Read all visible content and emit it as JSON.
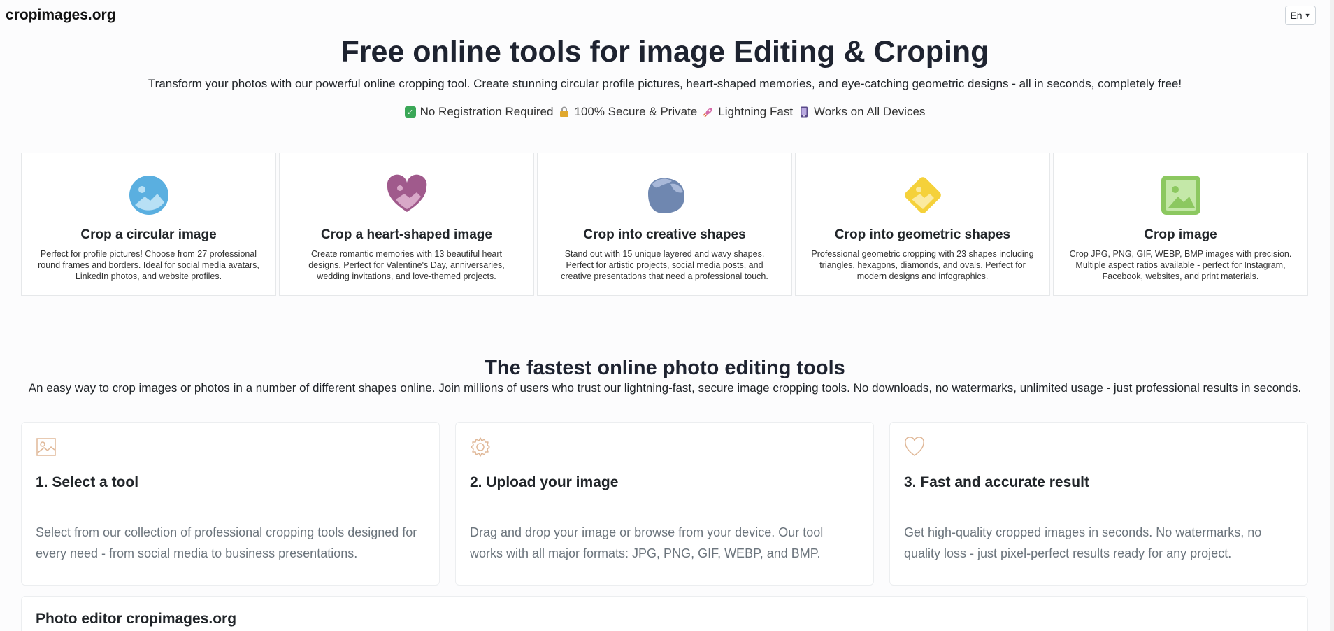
{
  "header": {
    "brand": "cropimages.org",
    "language": "En"
  },
  "hero": {
    "title": "Free online tools for image Editing & Croping",
    "subtitle": "Transform your photos with our powerful online cropping tool. Create stunning circular profile pictures, heart-shaped memories, and eye-catching geometric designs - all in seconds, completely free!",
    "features": [
      {
        "icon": "check-icon",
        "color": "#3aa757",
        "glyph": "✓",
        "label": "No Registration Required"
      },
      {
        "icon": "lock-icon",
        "color": "#e0a82e",
        "glyph": "",
        "label": "100% Secure & Private"
      },
      {
        "icon": "rocket-icon",
        "color": "#d46aa8",
        "glyph": "",
        "label": "Lightning Fast"
      },
      {
        "icon": "mobile-icon",
        "color": "#5a4a8a",
        "glyph": "",
        "label": "Works on All Devices"
      }
    ]
  },
  "tools": [
    {
      "icon": "circle-image-icon",
      "color": "#5aafe0",
      "title": "Crop a circular image",
      "desc": "Perfect for profile pictures! Choose from 27 professional round frames and borders. Ideal for social media avatars, LinkedIn photos, and website profiles."
    },
    {
      "icon": "heart-image-icon",
      "color": "#a05a8c",
      "title": "Crop a heart-shaped image",
      "desc": "Create romantic memories with 13 beautiful heart designs. Perfect for Valentine's Day, anniversaries, wedding invitations, and love-themed projects."
    },
    {
      "icon": "creative-shape-icon",
      "color": "#6f87b0",
      "title": "Crop into creative shapes",
      "desc": "Stand out with 15 unique layered and wavy shapes. Perfect for artistic projects, social media posts, and creative presentations that need a professional touch."
    },
    {
      "icon": "diamond-image-icon",
      "color": "#f5d13a",
      "title": "Crop into geometric shapes",
      "desc": "Professional geometric cropping with 23 shapes including triangles, hexagons, diamonds, and ovals. Perfect for modern designs and infographics."
    },
    {
      "icon": "square-image-icon",
      "color": "#8cc860",
      "title": "Crop image",
      "desc": "Crop JPG, PNG, GIF, WEBP, BMP images with precision. Multiple aspect ratios available - perfect for Instagram, Facebook, websites, and print materials."
    }
  ],
  "section": {
    "title": "The fastest online photo editing tools",
    "subtitle": "An easy way to crop images or photos in a number of different shapes online. Join millions of users who trust our lightning-fast, secure image cropping tools. No downloads, no watermarks, unlimited usage - just professional results in seconds."
  },
  "steps": [
    {
      "icon": "image-outline-icon",
      "title": "1. Select a tool",
      "desc": "Select from our collection of professional cropping tools designed for every need - from social media to business presentations."
    },
    {
      "icon": "gear-outline-icon",
      "title": "2. Upload your image",
      "desc": "Drag and drop your image or browse from your device. Our tool works with all major formats: JPG, PNG, GIF, WEBP, and BMP."
    },
    {
      "icon": "heart-outline-icon",
      "title": "3. Fast and accurate result",
      "desc": "Get high-quality cropped images in seconds. No watermarks, no quality loss - just pixel-perfect results ready for any project."
    }
  ],
  "editor": {
    "title": "Photo editor cropimages.org"
  },
  "colors": {
    "step_icon": "#e0b898"
  }
}
